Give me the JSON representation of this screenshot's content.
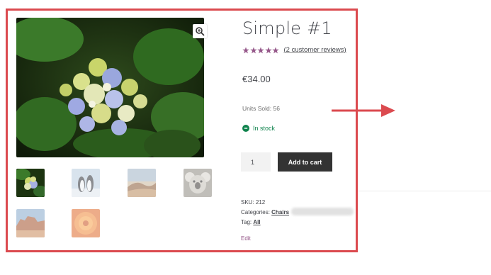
{
  "product": {
    "title": "Simple #1",
    "rating": {
      "stars": 5,
      "reviews_link": "(2 customer reviews)"
    },
    "price": "€34.00",
    "units_sold": "Units Sold: 56",
    "stock": "In stock",
    "quantity": "1",
    "add_to_cart": "Add to cart"
  },
  "meta": {
    "sku_label": "SKU:",
    "sku": "212",
    "categories_label": "Categories:",
    "category": "Chairs",
    "tag_label": "Tag:",
    "tag": "All",
    "edit": "Edit"
  },
  "gallery": {
    "main": "hydrangea-flower",
    "thumbnails": [
      "hydrangea-flower",
      "penguins",
      "desert-landscape",
      "koala",
      "red-rock-canyon",
      "orange-flower"
    ]
  },
  "colors": {
    "highlight_border": "#db4a4f",
    "arrow": "#db4a4f",
    "stars": "#96588a",
    "button": "#333333",
    "in_stock": "#0f834d",
    "edit_link": "#96588a"
  }
}
